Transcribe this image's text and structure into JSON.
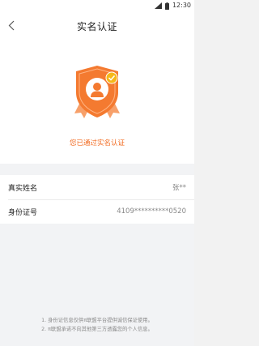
{
  "status_bar": {
    "time": "12:30",
    "icons": [
      "signal-icon",
      "battery-icon"
    ]
  },
  "header": {
    "title": "实名认证",
    "back_icon": "chevron-left-icon"
  },
  "hero": {
    "badge_icon": "verified-shield-icon",
    "status_text": "您已通过实名认证"
  },
  "info": {
    "rows": [
      {
        "label": "真实姓名",
        "value": "张**"
      },
      {
        "label": "身份证号",
        "value": "4109**********0520"
      }
    ]
  },
  "footer": {
    "notes": [
      "1. 身份证信息仅供π联盟平台提供诚信保证使用。",
      "2. π联盟承诺不向其他第三方透露您的个人信息。"
    ]
  },
  "colors": {
    "accent": "#f26b22",
    "badge_orange": "#f47a30",
    "check_yellow": "#f6b81a",
    "page_bg": "#f2f3f5"
  }
}
